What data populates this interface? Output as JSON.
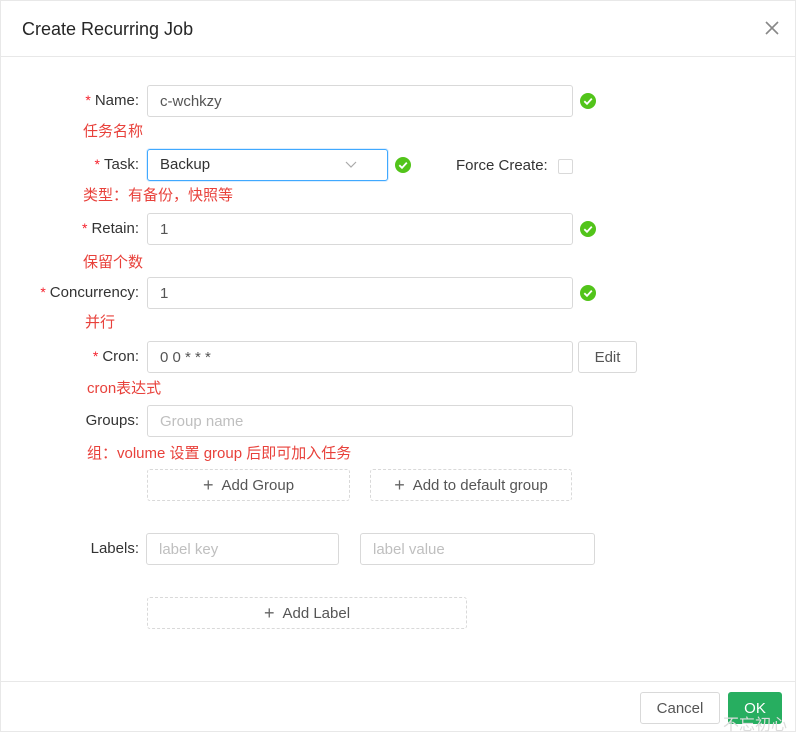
{
  "dialog": {
    "title": "Create Recurring Job"
  },
  "form": {
    "name": {
      "label": "Name:",
      "value": "c-wchkzy",
      "hint": "任务名称"
    },
    "task": {
      "label": "Task:",
      "value": "Backup",
      "hint": "类型：有备份，快照等",
      "force_create_label": "Force Create:"
    },
    "retain": {
      "label": "Retain:",
      "value": "1",
      "hint": "保留个数"
    },
    "concurrency": {
      "label": "Concurrency:",
      "value": "1",
      "hint": "并行"
    },
    "cron": {
      "label": "Cron:",
      "value": "0 0 * * *",
      "hint": "cron表达式",
      "edit_label": "Edit"
    },
    "groups": {
      "label": "Groups:",
      "placeholder": "Group name",
      "hint": "组：volume 设置 group 后即可加入任务",
      "add_group_label": "Add Group",
      "add_default_label": "Add to default group"
    },
    "labels": {
      "label": "Labels:",
      "key_placeholder": "label key",
      "value_placeholder": "label value",
      "add_label": "Add Label"
    }
  },
  "footer": {
    "cancel_label": "Cancel",
    "ok_label": "OK"
  },
  "watermark": "不忘初心",
  "colors": {
    "required": "#f5222d",
    "hint": "#e8413b",
    "valid": "#52c41a",
    "ok_button": "#27ae60"
  },
  "icons": {
    "valid": "check-circle-icon",
    "close": "close-icon",
    "dropdown": "chevron-down-icon",
    "add": "plus-icon"
  }
}
